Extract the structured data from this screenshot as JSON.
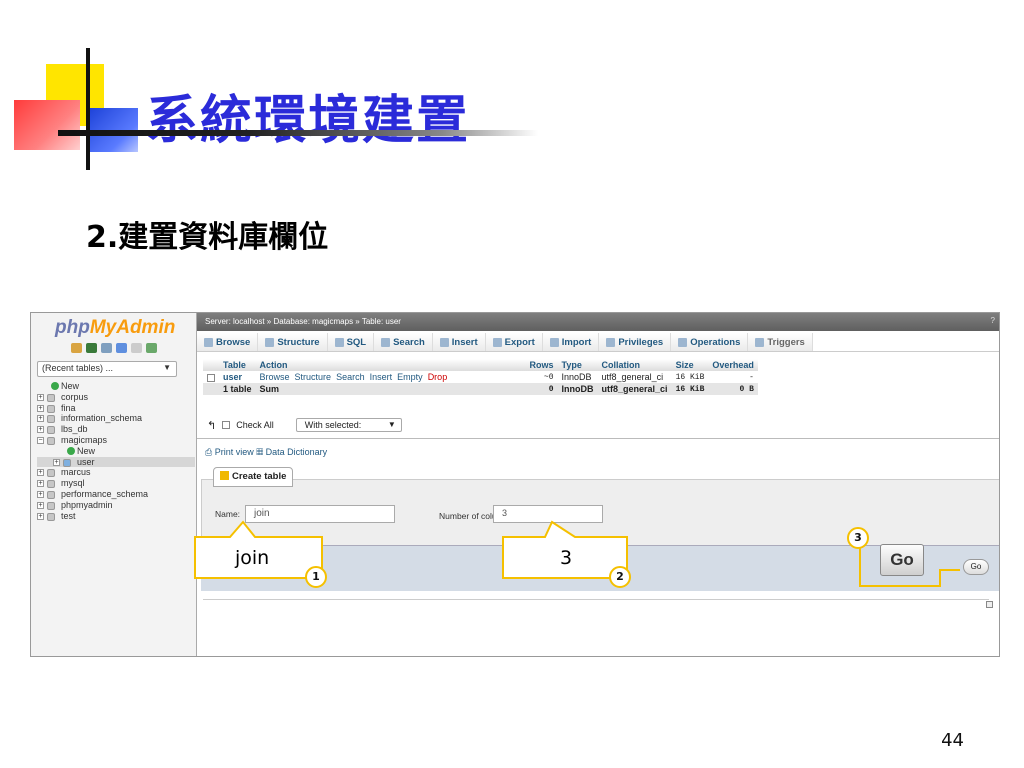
{
  "slide": {
    "title": "系統環境建置",
    "subtitle": "2.建置資料庫欄位",
    "page_number": "44"
  },
  "nav": {
    "logo_php": "php",
    "logo_myadmin": "MyAdmin",
    "recent_tables": "(Recent tables) ...",
    "tree": [
      {
        "label": "New",
        "type": "new"
      },
      {
        "label": "corpus",
        "type": "db"
      },
      {
        "label": "fina",
        "type": "db"
      },
      {
        "label": "information_schema",
        "type": "db"
      },
      {
        "label": "lbs_db",
        "type": "db"
      },
      {
        "label": "magicmaps",
        "type": "db",
        "expanded": true
      },
      {
        "label": "New",
        "type": "new",
        "sub": true
      },
      {
        "label": "user",
        "type": "table",
        "sub": true,
        "selected": true
      },
      {
        "label": "marcus",
        "type": "db"
      },
      {
        "label": "mysql",
        "type": "db"
      },
      {
        "label": "performance_schema",
        "type": "db"
      },
      {
        "label": "phpmyadmin",
        "type": "db"
      },
      {
        "label": "test",
        "type": "db"
      }
    ]
  },
  "breadcrumb": {
    "text": "Server: localhost » Database: magicmaps » Table: user",
    "help": "?"
  },
  "tabs": [
    "Browse",
    "Structure",
    "SQL",
    "Search",
    "Insert",
    "Export",
    "Import",
    "Privileges",
    "Operations",
    "Triggers"
  ],
  "table": {
    "headers": {
      "table": "Table",
      "action": "Action",
      "rows": "Rows",
      "type": "Type",
      "collation": "Collation",
      "size": "Size",
      "overhead": "Overhead"
    },
    "row": {
      "name": "user",
      "browse": "Browse",
      "structure": "Structure",
      "search": "Search",
      "insert": "Insert",
      "empty": "Empty",
      "drop": "Drop",
      "rows": "~0",
      "type": "InnoDB",
      "collation": "utf8_general_ci",
      "size": "16 KiB",
      "overhead": "-"
    },
    "sum": {
      "name": "1 table",
      "label": "Sum",
      "rows": "0",
      "type": "InnoDB",
      "collation": "utf8_general_ci",
      "size": "16 KiB",
      "overhead": "0 B"
    }
  },
  "checkall": {
    "label": "Check All",
    "with_selected": "With selected:"
  },
  "links": {
    "print_view": "Print view",
    "data_dictionary": "Data Dictionary"
  },
  "create_table": {
    "legend": "Create table",
    "name_label": "Name:",
    "name_value": "join",
    "columns_label": "Number of columns:",
    "columns_value": "3",
    "go": "Go"
  },
  "annotations": {
    "callout1": "join",
    "callout2": "3",
    "badge1": "1",
    "badge2": "2",
    "badge3": "3",
    "go_big": "Go"
  }
}
